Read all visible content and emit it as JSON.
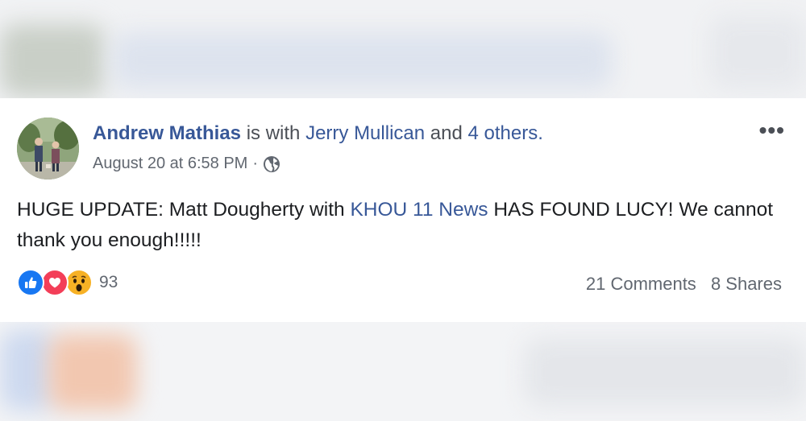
{
  "post": {
    "author": "Andrew Mathias",
    "with_text": "is with",
    "tagged_person": "Jerry Mullican",
    "and_text": "and",
    "others_link": "4 others.",
    "timestamp": "August 20 at 6:58 PM",
    "separator": "·",
    "privacy_icon": "globe-icon",
    "more_icon": "more-options-icon",
    "more_glyph": "•••",
    "body_part1": "HUGE UPDATE: Matt Dougherty with",
    "body_mention": "KHOU 11 News",
    "body_part2": "HAS FOUND LUCY! We cannot thank you enough!!!!!"
  },
  "reactions": {
    "icons": [
      "like-icon",
      "love-icon",
      "wow-icon"
    ],
    "count": "93"
  },
  "stats": {
    "comments": "21 Comments",
    "shares": "8 Shares"
  },
  "colors": {
    "link": "#385898",
    "text": "#1c1e21",
    "secondary": "#616770",
    "like": "#1877f2",
    "love": "#f33e58",
    "wow": "#f7b125"
  }
}
